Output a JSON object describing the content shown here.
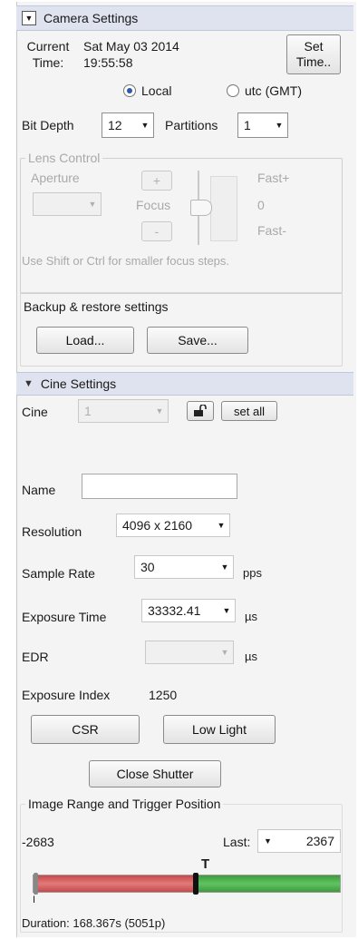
{
  "camera_settings": {
    "header": "Camera Settings",
    "current_time_label_line1": "Current",
    "current_time_label_line2": "Time:",
    "date": "Sat May 03 2014",
    "time": "19:55:58",
    "set_time_line1": "Set",
    "set_time_line2": "Time..",
    "radio_local": "Local",
    "radio_utc": "utc (GMT)",
    "selected_tz": "Local",
    "bit_depth_label": "Bit Depth",
    "bit_depth_value": "12",
    "partitions_label": "Partitions",
    "partitions_value": "1"
  },
  "lens_control": {
    "title": "Lens Control",
    "aperture_label": "Aperture",
    "plus": "+",
    "minus": "-",
    "focus_label": "Focus",
    "fast_plus": "Fast+",
    "zero": "0",
    "fast_minus": "Fast-",
    "hint": "Use Shift or Ctrl for smaller focus steps."
  },
  "backup": {
    "title": "Backup & restore settings",
    "load": "Load...",
    "save": "Save..."
  },
  "cine_settings": {
    "header": "Cine Settings",
    "cine_label": "Cine",
    "cine_value": "1",
    "set_all": "set all",
    "name_label": "Name",
    "name_value": "",
    "resolution_label": "Resolution",
    "resolution_value": "4096 x 2160",
    "sample_rate_label": "Sample Rate",
    "sample_rate_value": "30",
    "sample_rate_unit": "pps",
    "exposure_time_label": "Exposure Time",
    "exposure_time_value": "33332.41",
    "exposure_time_unit": "µs",
    "edr_label": "EDR",
    "edr_value": "",
    "edr_unit": "µs",
    "exposure_index_label": "Exposure Index",
    "exposure_index_value": "1250",
    "csr": "CSR",
    "low_light": "Low Light",
    "close_shutter": "Close Shutter"
  },
  "image_range": {
    "title": "Image Range and Trigger Position",
    "first": "-2683",
    "last_label": "Last:",
    "last_value": "2367",
    "trigger_marker": "T",
    "start_marker": "I",
    "duration": "Duration: 168.367s (5051p)",
    "pre_trigger_color": "#c84a4a",
    "post_trigger_color": "#3e9a3e",
    "trigger_fraction": 0.531
  }
}
